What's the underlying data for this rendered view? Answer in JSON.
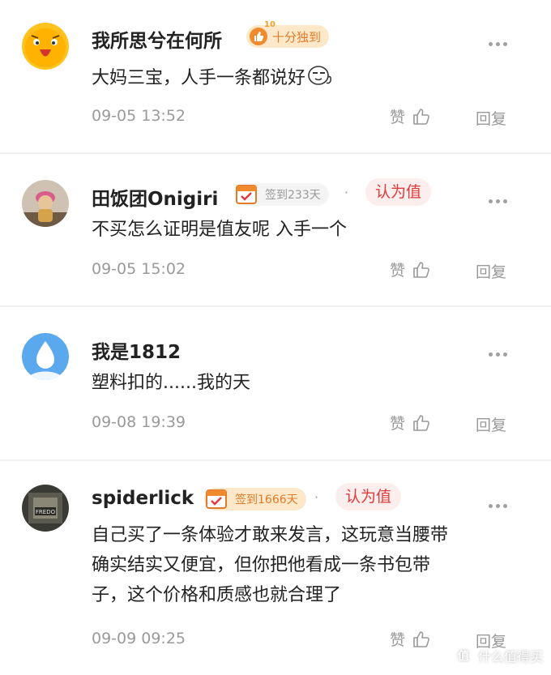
{
  "comments": [
    {
      "username": "我所思兮在何所",
      "badge": {
        "type": "top",
        "number": "10",
        "label": "十分独到"
      },
      "text_lines": [
        "大妈三宝，人手一条都说好"
      ],
      "time": "09-05 13:52",
      "like_label": "赞",
      "reply_label": "回复"
    },
    {
      "username": "田饭团Onigiri",
      "badge": {
        "type": "sign",
        "label": "签到233天"
      },
      "worth_label": "认为值",
      "text_lines": [
        "不买怎么证明是值友呢 入手一个"
      ],
      "time": "09-05 15:02",
      "like_label": "赞",
      "reply_label": "回复"
    },
    {
      "username": "我是1812",
      "text_lines": [
        "塑料扣的......我的天"
      ],
      "time": "09-08 19:39",
      "like_label": "赞",
      "reply_label": "回复"
    },
    {
      "username": "spiderlick",
      "badge": {
        "type": "sign",
        "label": "签到1666天"
      },
      "worth_label": "认为值",
      "text_lines": [
        "自己买了一条体验才敢来发言，这玩意当腰带",
        "确实结实又便宜，但你把他看成一条书包带",
        "子，这个价格和质感也就合理了"
      ],
      "time": "09-09 09:25",
      "like_label": "赞",
      "reply_label": "回复"
    }
  ],
  "avatar4_label": "FREDO",
  "watermark": {
    "icon_char": "值",
    "text": "什么值得买"
  },
  "colors": {
    "accent_orange": "#e07b2a",
    "worth_red": "#e03a3a",
    "meta_gray": "#9a9a9a"
  }
}
